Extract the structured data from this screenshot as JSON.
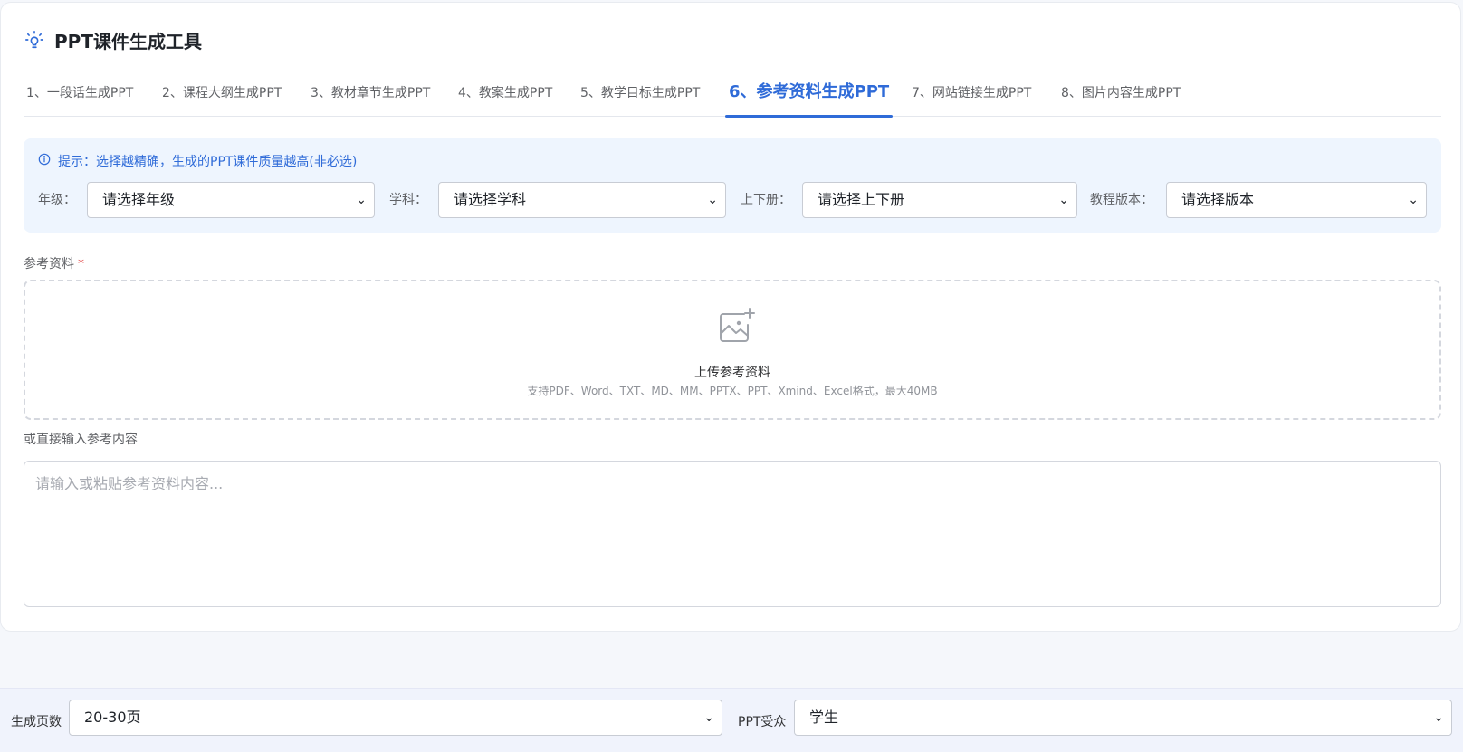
{
  "header": {
    "title": "PPT课件生成工具",
    "icon": "lightbulb-icon"
  },
  "tabs": [
    {
      "label": "1、一段话生成PPT",
      "active": false
    },
    {
      "label": "2、课程大纲生成PPT",
      "active": false
    },
    {
      "label": "3、教材章节生成PPT",
      "active": false
    },
    {
      "label": "4、教案生成PPT",
      "active": false
    },
    {
      "label": "5、教学目标生成PPT",
      "active": false
    },
    {
      "label": "6、参考资料生成PPT",
      "active": true
    },
    {
      "label": "7、网站链接生成PPT",
      "active": false
    },
    {
      "label": "8、图片内容生成PPT",
      "active": false
    }
  ],
  "hint": {
    "text": "提示：选择越精确，生成的PPT课件质量越高(非必选)",
    "grade_label": "年级：",
    "grade_value": "请选择年级",
    "subject_label": "学科：",
    "subject_value": "请选择学科",
    "volume_label": "上下册：",
    "volume_value": "请选择上下册",
    "edition_label": "教程版本：",
    "edition_value": "请选择版本"
  },
  "reference": {
    "label": "参考资料",
    "required_mark": "*",
    "upload_title": "上传参考资料",
    "upload_sub": "支持PDF、Word、TXT、MD、MM、PPTX、PPT、Xmind、Excel格式，最大40MB",
    "direct_label": "或直接输入参考内容",
    "textarea_placeholder": "请输入或粘贴参考资料内容..."
  },
  "bottom": {
    "pages_label": "生成页数",
    "pages_value": "20-30页",
    "audience_label": "PPT受众",
    "audience_value": "学生"
  },
  "colors": {
    "accent": "#2f6bd8",
    "hint_bg": "#eef5fe",
    "required": "#e34d4d"
  }
}
